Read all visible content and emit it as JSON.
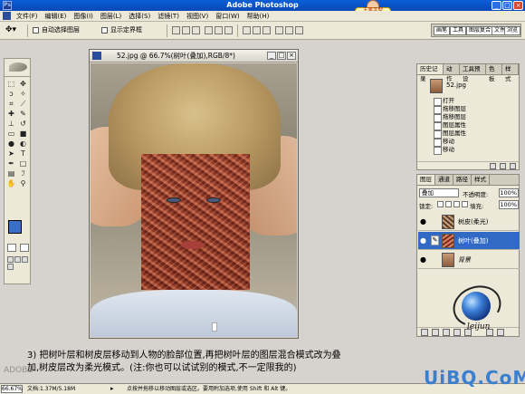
{
  "window": {
    "title": "Adobe Photoshop",
    "badge": "五笔字型"
  },
  "menu": [
    "文件(F)",
    "编辑(E)",
    "图像(I)",
    "图层(L)",
    "选择(S)",
    "滤镜(T)",
    "视图(V)",
    "窗口(W)",
    "帮助(H)"
  ],
  "options": {
    "auto_select": "自动选择图层",
    "show_bounds": "显示定界框",
    "well_tabs": [
      "画笔",
      "工具",
      "图层复合",
      "文件",
      "浏览"
    ]
  },
  "document": {
    "title": "52.jpg @ 66.7%(树叶(叠加),RGB/8*)"
  },
  "history": {
    "tabs": [
      "历史记录",
      "动作",
      "工具预设",
      "色板",
      "样式"
    ],
    "snapshot": "52.jpg",
    "items": [
      "打开",
      "拖移图层",
      "拖移图层",
      "图层属性",
      "图层属性",
      "移动",
      "移动"
    ]
  },
  "layers": {
    "tabs": [
      "图层",
      "通道",
      "路径",
      "样式"
    ],
    "blend_mode": "叠加",
    "opacity_label": "不透明度:",
    "opacity": "100%",
    "lock_label": "锁定:",
    "fill_label": "填充:",
    "fill": "100%",
    "items": [
      {
        "name": "树皮(柔光)",
        "active": false
      },
      {
        "name": "树叶(叠加)",
        "active": true
      },
      {
        "name": "背景",
        "active": false
      }
    ]
  },
  "caption": {
    "line1": "3) 把树叶层和树皮层移动到人物的脸部位置,再把树叶层的图层混合模式改为叠",
    "line2": "加,树皮层改为柔光模式。(注:你也可以试试别的模式,不一定限我的)"
  },
  "status": {
    "zoom": "66.67%",
    "doc": "文档:1.37M/5.18M",
    "hint": "点按并拖移以移动图层或选区。要用附加选项,使用 Shift 和 Alt 键。"
  },
  "logo_signature": "leijun",
  "watermark": "UiBQ.CoM",
  "watermark_small": "ADOBE"
}
